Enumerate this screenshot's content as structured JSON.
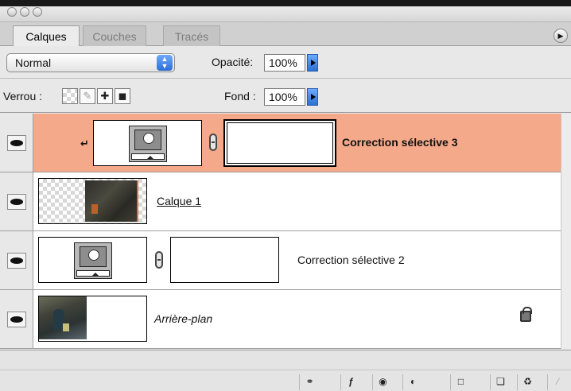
{
  "window": {
    "controls": [
      "close",
      "minimize",
      "zoom"
    ]
  },
  "tabs": [
    {
      "label": "Calques",
      "active": true
    },
    {
      "label": "Couches",
      "active": false
    },
    {
      "label": "Tracés",
      "active": false
    }
  ],
  "blend_mode": {
    "value": "Normal"
  },
  "opacity": {
    "label": "Opacité:",
    "value": "100%"
  },
  "lock": {
    "label": "Verrou :",
    "icons": [
      "lock-transparency-icon",
      "lock-paint-icon",
      "lock-position-icon",
      "lock-all-icon"
    ]
  },
  "fill": {
    "label": "Fond :",
    "value": "100%"
  },
  "layers": [
    {
      "name": "Correction sélective 3",
      "type": "adjustment",
      "selected": true,
      "clipped": true,
      "visible": true
    },
    {
      "name": "Calque 1",
      "type": "pixel",
      "selected": false,
      "visible": true
    },
    {
      "name": "Correction sélective 2",
      "type": "adjustment",
      "selected": false,
      "visible": true
    },
    {
      "name": "Arrière-plan",
      "type": "background",
      "selected": false,
      "locked": true,
      "visible": true
    }
  ],
  "bottom_buttons": [
    "link-icon",
    "layer-style-icon",
    "mask-icon",
    "adjustment-icon",
    "folder-icon",
    "new-layer-icon",
    "trash-icon"
  ],
  "colors": {
    "selection": "#f4a98a",
    "accent_blue": "#2d6fd6"
  }
}
